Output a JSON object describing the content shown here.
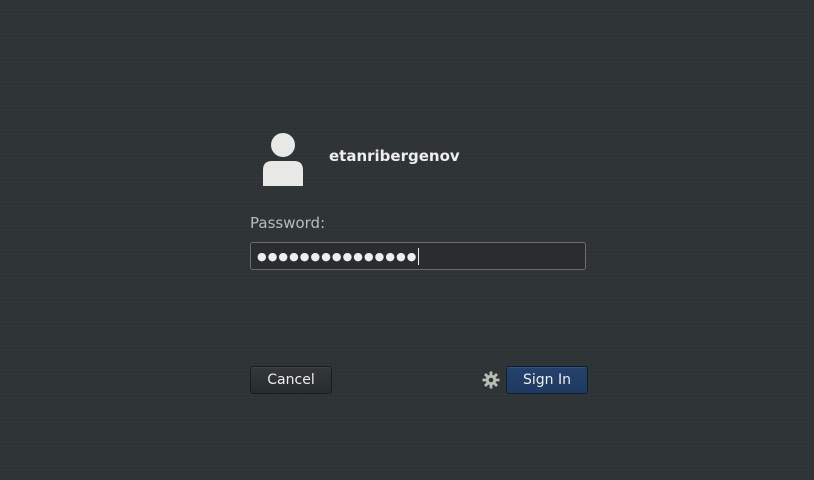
{
  "user": {
    "name": "etanribergenov",
    "avatar_icon": "user-silhouette-icon"
  },
  "password": {
    "label": "Password:",
    "masked_value": "●●●●●●●●●●●●●●●"
  },
  "actions": {
    "cancel_label": "Cancel",
    "sign_in_label": "Sign In",
    "settings_icon": "gear-icon"
  },
  "colors": {
    "background": "#2e3436",
    "sign_in_button": "#213d66",
    "text": "#eeeeec"
  }
}
